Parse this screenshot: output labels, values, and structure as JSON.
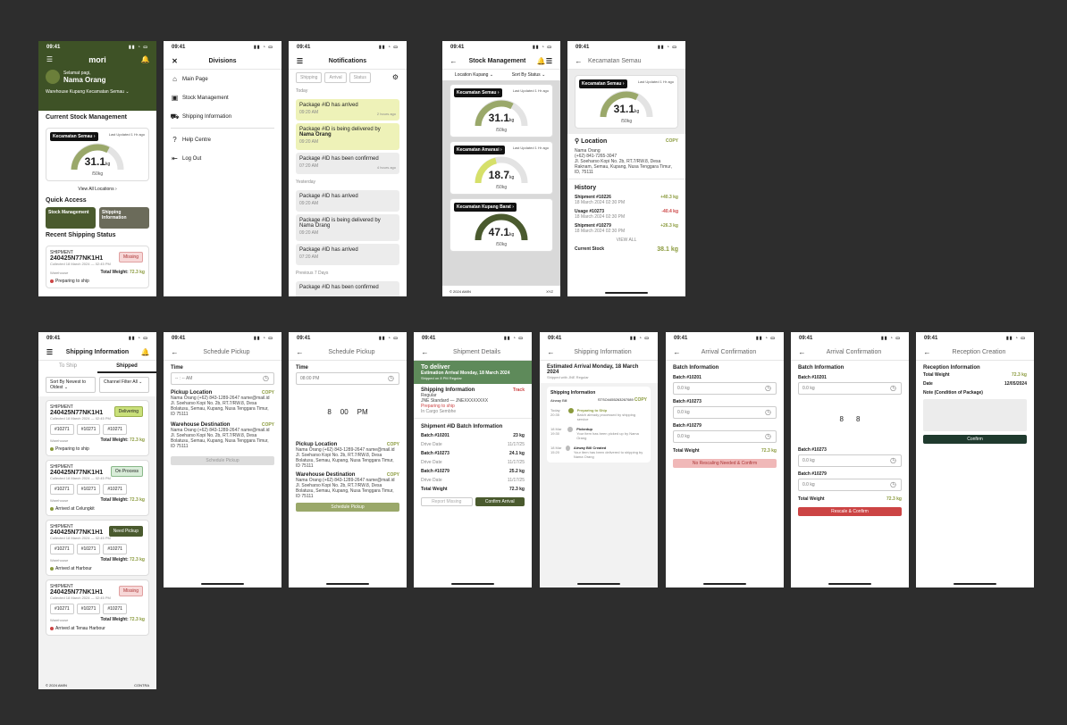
{
  "time": "09:41",
  "home": {
    "logo": "mori",
    "welcome": "Selamat pagi,",
    "user": "Nama Orang",
    "warehouse": "Warehouse Kupang Kecamatan Semau",
    "current_title": "Current Stock Management",
    "location": "Kecamatan Semau",
    "updated": "Last Updated 1 Hr ago",
    "value": "31.1",
    "unit": "kg",
    "max": "/50kg",
    "view_all": "View All Locations",
    "quick_title": "Quick Access",
    "qa1": "Stock Management",
    "qa2": "Shipping Information",
    "recent_title": "Recent Shipping Status",
    "ship_label": "SHIPMENT",
    "ship_id": "240425N77NK1H1",
    "ship_date": "Collected 18 March 2024 — 02:45 PM",
    "badge": "Missing",
    "total_label": "Total Weight:",
    "total": "72.3 kg",
    "status": "Preparing to ship",
    "muted": "Warehouse"
  },
  "div": {
    "title": "Divisions",
    "items": [
      "Main Page",
      "Stock Management",
      "Shipping Information",
      "Help Centre",
      "Log Out"
    ]
  },
  "notif": {
    "title": "Notifications",
    "tabs": [
      "Shipping",
      "Arrival",
      "Status"
    ],
    "today": "Today",
    "yesterday": "Yesterday",
    "prev": "Previous 7 Days",
    "n1": "Package #ID has arrived",
    "n2a": "Package #ID is being delivered by",
    "n2b": "Nama Orang",
    "n3": "Package #ID has been confirmed",
    "n4": "Package #ID has arrived",
    "n5": "Package #ID is being delivered by Nama Orang",
    "n6": "Package #ID has arrived",
    "n7": "Package #ID has been confirmed",
    "t1": "09:20 AM",
    "t2": "09:20 AM",
    "t3": "07:20 AM",
    "ago1": "2 hours ago",
    "ago3": "4 hours ago"
  },
  "stock": {
    "title": "Stock Management",
    "f1": "Location Kupang",
    "f2": "Sort By Status",
    "c1": "Kecamatan Semau",
    "v1": "31.1",
    "c2": "Kecamatan Amarasi",
    "v2": "18.7",
    "c3": "Kecamatan Kupang Barat",
    "v3": "47.1",
    "max": "/50kg",
    "foot": "© 2024 AMIN",
    "foot2": "XYZ",
    "upd": "Last Updated 1 Hr ago"
  },
  "detail": {
    "title": "Kecamatan Semau",
    "loc": "Location",
    "copy": "COPY",
    "addr1": "Nama Orang",
    "addr2": "(+62) 841-7265-3047",
    "addr3": "Jl. Soeharso Kopi No. 2b, RT.7/RW.8, Desa Raknam, Semau, Kupang, Nusa Tenggara Timur, ID, 75111",
    "hist": "History",
    "h1": "Shipment #10226",
    "h1v": "+40.3 kg",
    "h2": "Usage #10273",
    "h2v": "-40.4 kg",
    "h3": "Shipment #10279",
    "h3v": "+26.3 kg",
    "hd": "18 March 2024 02:30 PM",
    "viewall": "VIEW ALL",
    "cur": "Current Stock",
    "curv": "38.1 kg"
  },
  "shipinfo": {
    "title": "Shipping Information",
    "tab1": "To Ship",
    "tab2": "Shipped",
    "sort": "Sort By Newest to Oldest",
    "ch": "Channel Filter All",
    "b1": "Delivering",
    "b2": "On Process",
    "b3": "Need Pickup",
    "b4": "Missing",
    "chip": "#10271",
    "s1": "Preparing to ship",
    "s2": "Arrived at Celungkit",
    "s3": "Arrived at Harbour",
    "s4": "Arrived at Tenau Harbour",
    "foot": "© 2024 AMIN",
    "foot2": "CONTRA"
  },
  "sched": {
    "title": "Schedule Pickup",
    "time": "Time",
    "ph": "-- : -- AM",
    "time2": "08:00 PM",
    "pick": "Pickup Location",
    "wh": "Warehouse Destination",
    "addr": "Nama Orang (+62) 843-1289-2647 name@mail.id Jl. Soeharso Kopi No. 2b, RT.7/RW.8, Desa Bolatusu, Semau, Kupang, Nusa Tenggara Timur, ID 75111",
    "btn": "Schedule Pickup",
    "h": "8",
    "m": "00",
    "ap": "PM"
  },
  "sdetail": {
    "title": "Shipment Details",
    "deliver": "To deliver",
    "eta": "Estimation Arrival Monday, 18 March 2024",
    "sub": "Shipped on 8 PM Regular",
    "info": "Shipping Information",
    "track": "Track",
    "reg": "Regular",
    "jne": "JNE Standard — JNEXXXXXXXX",
    "prep": "Preparing to ship",
    "prep2": "In Cargo Sembhe",
    "batch_title": "Shipment #ID Batch Information",
    "b1": "Batch #10201",
    "b1v": "23 kg",
    "b2": "Batch #10273",
    "b2v": "24.1 kg",
    "b3": "Batch #10279",
    "b3v": "25.2 kg",
    "dd": "Drive Date",
    "ed": "Expired Date",
    "date": "11/17/25",
    "tw": "Total Weight",
    "twv": "72.3 kg",
    "btn1": "Report Missing",
    "btn2": "Confirm Arrival"
  },
  "sinfo2": {
    "title": "Shipping Information",
    "eta": "Estimated Arrival Monday, 18 March 2024",
    "sub": "Shipped with JNE Regular",
    "info": "Shipping Information",
    "jne": "Airway Bill",
    "awb": "STSO4455263267089",
    "copy": "COPY",
    "t1": "Preparing to Ship",
    "t1d": "Batch already processed by shipping service",
    "t2": "Pickedup",
    "t2d": "Your item has been picked up by Nama Orang",
    "t3": "Airway Bill Created",
    "t3d": "Your item has been delivered to shipping by Nama Orang",
    "d1": "Today 20:35",
    "d2": "18 Mar 19:30",
    "d3": "18 Mar 15:20"
  },
  "arr": {
    "title": "Arrival Confirmation",
    "bi": "Batch Information",
    "b1": "Batch #10201",
    "b2": "Batch #10273",
    "b3": "Batch #10279",
    "val": "0.0 kg",
    "tw": "Total Weight",
    "twv": "72.3 kg",
    "btn": "No Rescaling Needed & Confirm",
    "btn2": "Rescale & Confirm"
  },
  "rec": {
    "title": "Reception Creation",
    "ri": "Reception Information",
    "tw": "Total Weight",
    "twv": "72.3 kg",
    "date": "Date",
    "datev": "12/05/2024",
    "note": "Note (Condition of Package)",
    "btn": "Confirm"
  }
}
